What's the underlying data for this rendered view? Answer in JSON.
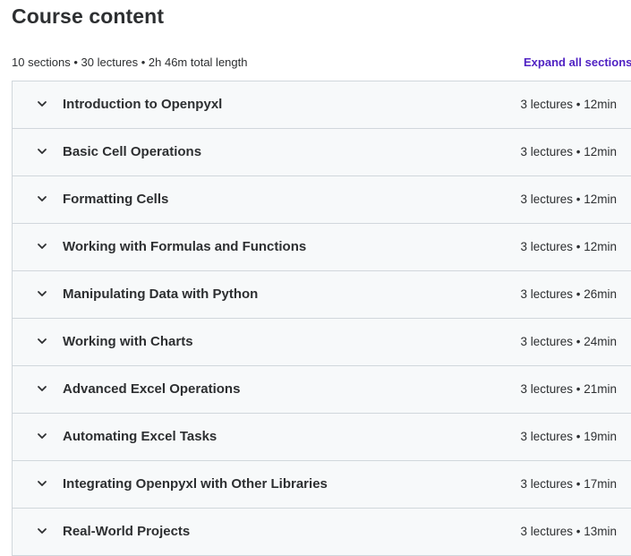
{
  "header": {
    "title": "Course content",
    "summary": "10 sections • 30 lectures • 2h 46m total length",
    "expand_label": "Expand all sections"
  },
  "icons": {
    "section_toggle": "chevron-down-icon"
  },
  "colors": {
    "accent": "#5022c3",
    "section_bg": "#f7f9fa",
    "border": "#d1d7dc",
    "text": "#2d2f31"
  },
  "sections": [
    {
      "title": "Introduction to Openpyxl",
      "meta": "3 lectures • 12min"
    },
    {
      "title": "Basic Cell Operations",
      "meta": "3 lectures • 12min"
    },
    {
      "title": "Formatting Cells",
      "meta": "3 lectures • 12min"
    },
    {
      "title": "Working with Formulas and Functions",
      "meta": "3 lectures • 12min"
    },
    {
      "title": "Manipulating Data with Python",
      "meta": "3 lectures • 26min"
    },
    {
      "title": "Working with Charts",
      "meta": "3 lectures • 24min"
    },
    {
      "title": "Advanced Excel Operations",
      "meta": "3 lectures • 21min"
    },
    {
      "title": "Automating Excel Tasks",
      "meta": "3 lectures • 19min"
    },
    {
      "title": "Integrating Openpyxl with Other Libraries",
      "meta": "3 lectures • 17min"
    },
    {
      "title": "Real-World Projects",
      "meta": "3 lectures • 13min"
    }
  ]
}
